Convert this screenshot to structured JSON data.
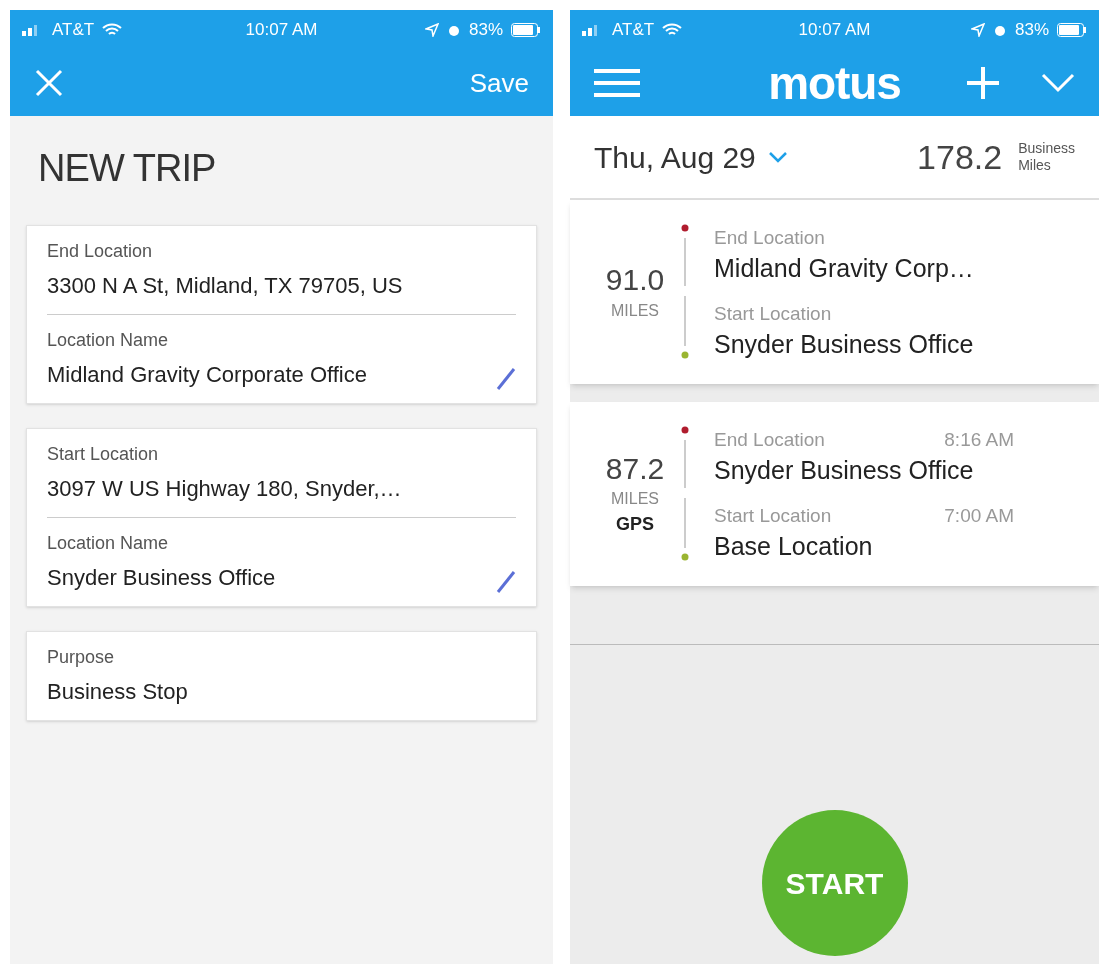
{
  "left_screen": {
    "status_bar": {
      "carrier": "AT&T",
      "time": "10:07 AM",
      "battery": "83%"
    },
    "nav": {
      "save": "Save"
    },
    "title": "NEW TRIP",
    "sections": [
      {
        "fields": [
          {
            "label": "End Location",
            "value": "3300 N A St, Midland, TX 79705, US",
            "editable": false
          },
          {
            "label": "Location Name",
            "value": "Midland Gravity Corporate Office",
            "editable": true
          }
        ]
      },
      {
        "fields": [
          {
            "label": "Start Location",
            "value": "3097 W US Highway 180, Snyder,…",
            "editable": false
          },
          {
            "label": "Location Name",
            "value": "Snyder Business Office",
            "editable": true
          }
        ]
      },
      {
        "fields": [
          {
            "label": "Purpose",
            "value": "Business Stop",
            "editable": false
          }
        ]
      }
    ]
  },
  "right_screen": {
    "status_bar": {
      "carrier": "AT&T",
      "time": "10:07 AM",
      "battery": "83%"
    },
    "nav": {
      "logo": "motus"
    },
    "summary": {
      "date": "Thu, Aug 29",
      "miles": "178.2",
      "miles_label_1": "Business",
      "miles_label_2": "Miles"
    },
    "trips": [
      {
        "miles": "91.0",
        "unit": "MILES",
        "end_label": "End Location",
        "end_name": "Midland Gravity Corp…",
        "start_label": "Start Location",
        "start_name": "Snyder Business Office"
      },
      {
        "miles": "87.2",
        "unit": "MILES",
        "source": "GPS",
        "end_label": "End Location",
        "end_name": "Snyder Business Office",
        "end_time": "8:16 AM",
        "start_label": "Start Location",
        "start_name": "Base Location",
        "start_time": "7:00 AM"
      }
    ],
    "start_button": "START"
  }
}
